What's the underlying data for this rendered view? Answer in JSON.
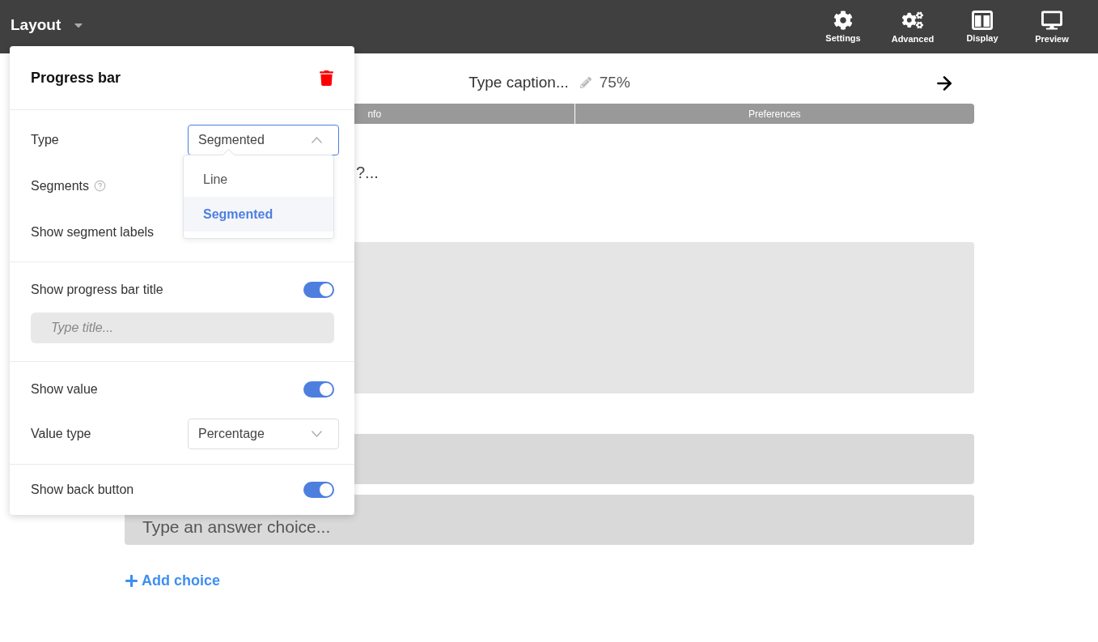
{
  "top_bar": {
    "title": "Layout",
    "actions": [
      {
        "kind": "settings",
        "label": "Settings"
      },
      {
        "kind": "advanced",
        "label": "Advanced"
      },
      {
        "kind": "display",
        "label": "Display"
      },
      {
        "kind": "preview",
        "label": "Preview"
      }
    ]
  },
  "survey": {
    "caption": "Type caption...",
    "progress": "75%",
    "segments": [
      {
        "label": "nfo"
      },
      {
        "label": "Preferences"
      }
    ],
    "question_fragment": "?...",
    "answers": [
      {
        "placeholder": "Type an answer choice..."
      }
    ],
    "add_choice": "Add choice"
  },
  "panel": {
    "title": "Progress bar",
    "sections": [
      {
        "rows": [
          {
            "kind": "select",
            "label": "Type",
            "value": "Segmented",
            "open": true,
            "options": [
              {
                "label": "Line",
                "selected": false
              },
              {
                "label": "Segmented",
                "selected": true
              }
            ]
          },
          {
            "kind": "label",
            "label": "Segments",
            "help": true
          },
          {
            "kind": "label",
            "label": "Show segment labels",
            "help": false
          }
        ]
      },
      {
        "rows": [
          {
            "kind": "toggle",
            "label": "Show progress bar title",
            "on": true
          },
          {
            "kind": "field",
            "placeholder": "Type title..."
          }
        ]
      },
      {
        "rows": [
          {
            "kind": "toggle",
            "label": "Show value",
            "on": true
          },
          {
            "kind": "select",
            "label": "Value type",
            "value": "Percentage",
            "open": false
          }
        ]
      },
      {
        "rows": [
          {
            "kind": "toggle",
            "label": "Show back button",
            "on": true
          }
        ]
      }
    ]
  }
}
